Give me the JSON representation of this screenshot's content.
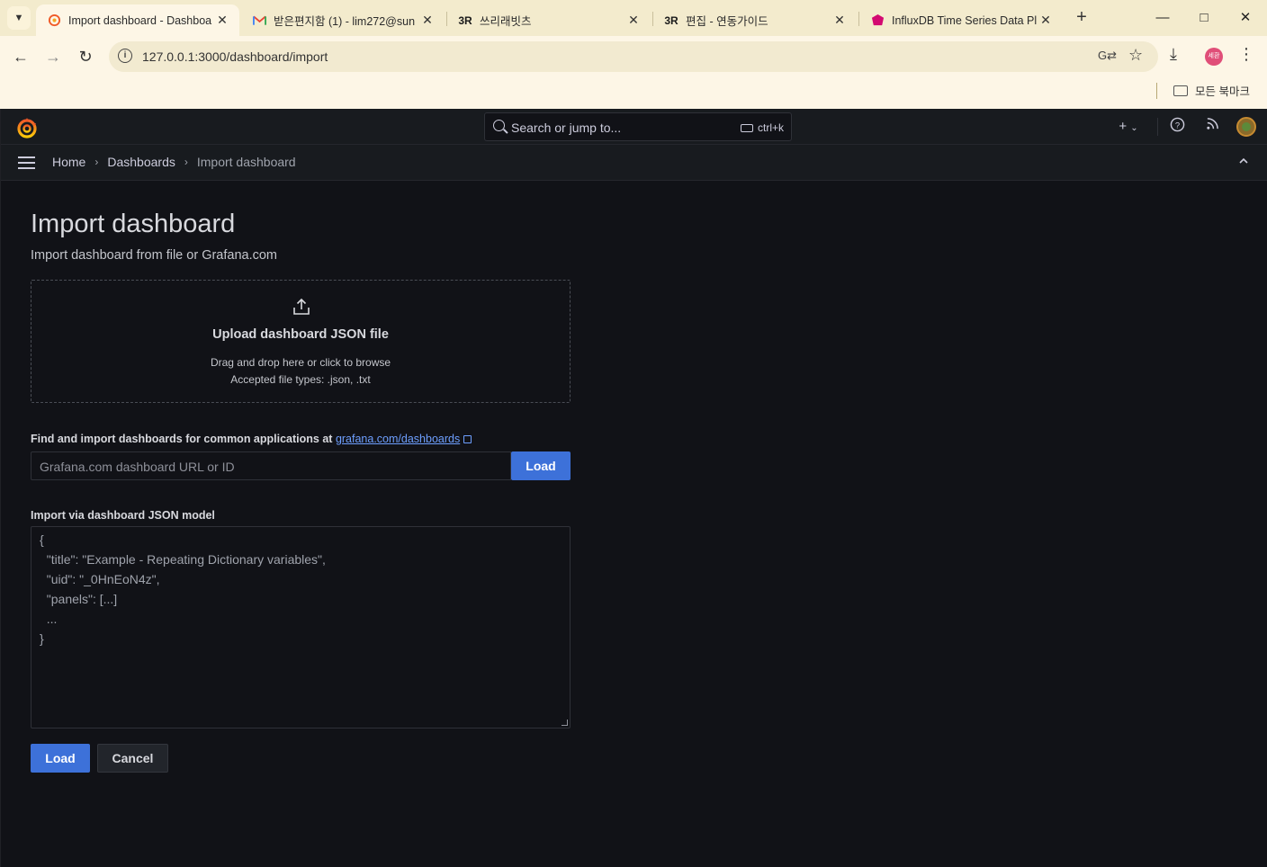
{
  "browser": {
    "tabs": [
      {
        "title": "Import dashboard - Dashboa",
        "favicon": "grafana-logo-icon",
        "active": true
      },
      {
        "title": "받은편지함 (1) - lim272@sun",
        "favicon": "gmail-icon",
        "active": false
      },
      {
        "title": "쓰리래빗츠",
        "favicon": "3r-icon",
        "favicon_text": "3R",
        "active": false
      },
      {
        "title": "편집 - 연동가이드",
        "favicon": "3r-icon",
        "favicon_text": "3R",
        "active": false
      },
      {
        "title": "InfluxDB Time Series Data Pl",
        "favicon": "influxdb-icon",
        "active": false
      }
    ],
    "url": "127.0.0.1:3000/dashboard/import",
    "profile_label": "세환",
    "bookmarks_folder": "모든 북마크",
    "colors": {
      "tabstrip": "#f3ebcd",
      "toolbar": "#fdf6e6"
    }
  },
  "grafana": {
    "search": {
      "placeholder": "Search or jump to...",
      "shortcut": "ctrl+k"
    },
    "breadcrumbs": [
      "Home",
      "Dashboards",
      "Import dashboard"
    ],
    "page": {
      "title": "Import dashboard",
      "subtitle": "Import dashboard from file or Grafana.com"
    },
    "upload": {
      "title": "Upload dashboard JSON file",
      "hint": "Drag and drop here or click to browse",
      "accepted": "Accepted file types: .json, .txt"
    },
    "gcom": {
      "label": "Find and import dashboards for common applications at",
      "link_text": "grafana.com/dashboards",
      "placeholder": "Grafana.com dashboard URL or ID",
      "load_label": "Load"
    },
    "json_model": {
      "label": "Import via dashboard JSON model",
      "placeholder_lines": [
        "{",
        "  \"title\": \"Example - Repeating Dictionary variables\",",
        "  \"uid\": \"_0HnEoN4z\",",
        "  \"panels\": [...]",
        "  ...",
        "}"
      ]
    },
    "actions": {
      "load_label": "Load",
      "cancel_label": "Cancel"
    },
    "colors": {
      "background": "#111217",
      "panel": "#181b1f",
      "primary": "#3d71d9",
      "link": "#6e9fff"
    }
  }
}
